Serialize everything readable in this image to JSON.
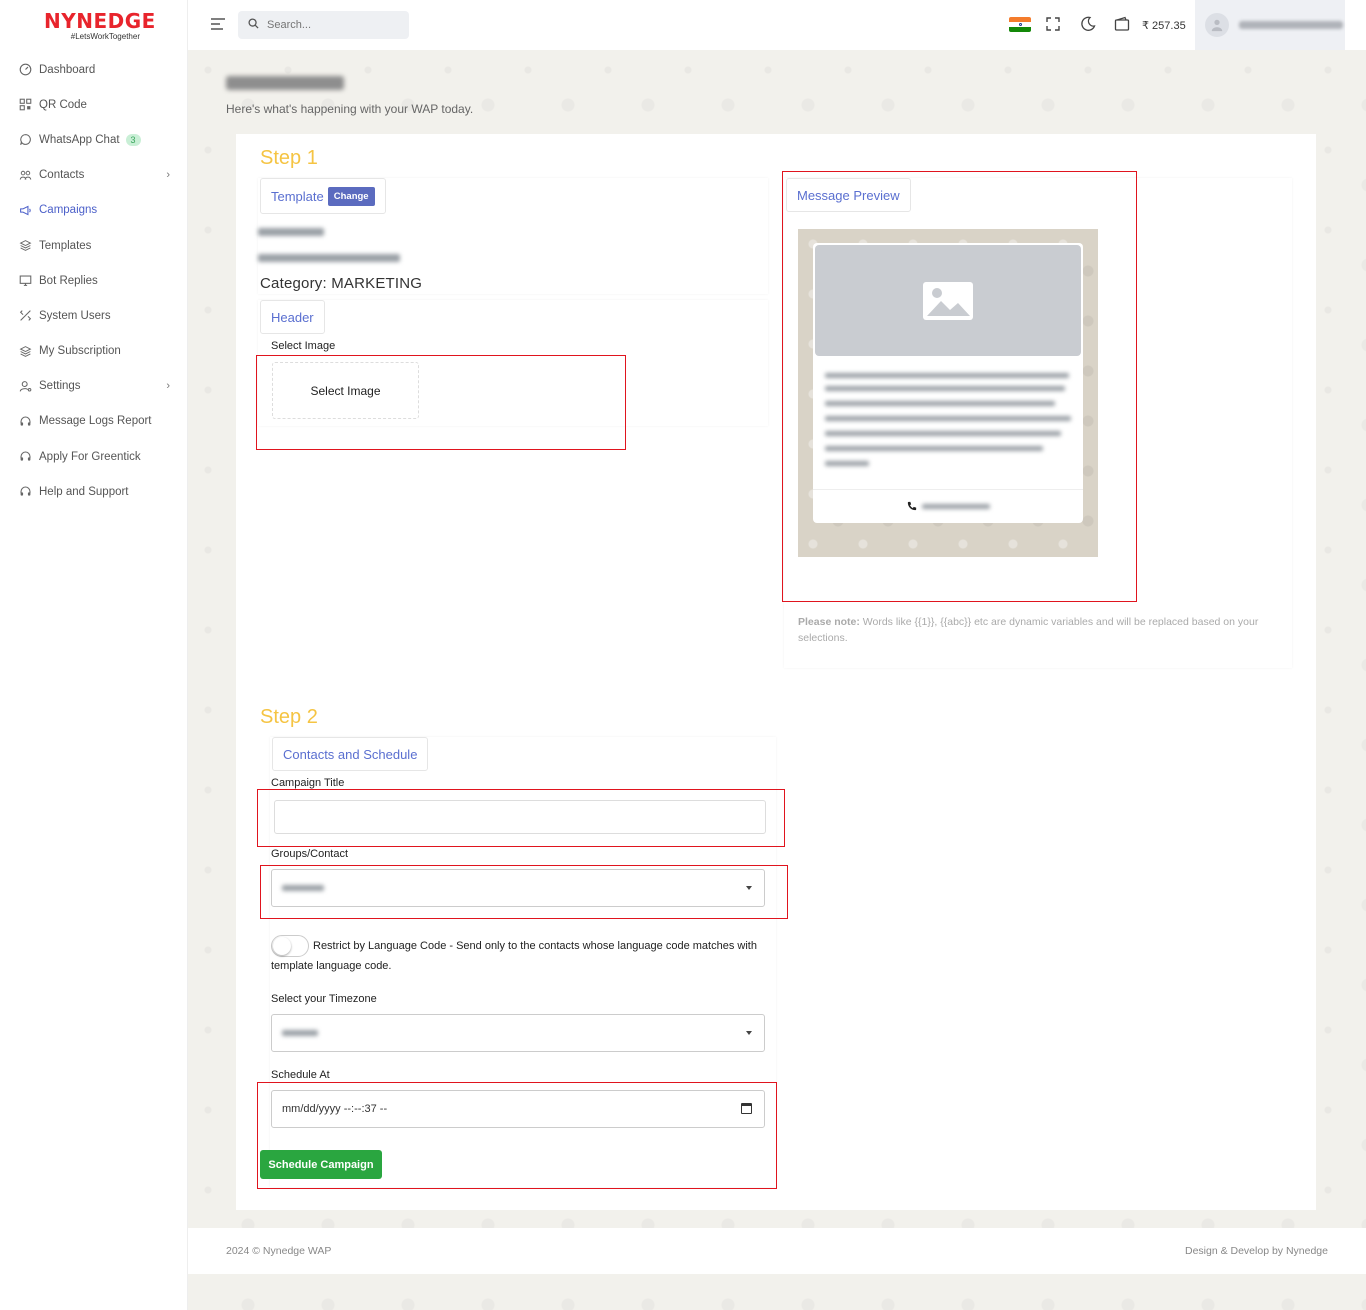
{
  "brand": {
    "name": "NYNEDGE",
    "tagline": "#LetsWorkTogether"
  },
  "sidebar": {
    "items": [
      {
        "label": "Dashboard",
        "icon": "dashboard-icon"
      },
      {
        "label": "QR Code",
        "icon": "qr-code-icon"
      },
      {
        "label": "WhatsApp Chat",
        "icon": "chat-icon",
        "badge": "3"
      },
      {
        "label": "Contacts",
        "icon": "contacts-icon",
        "has_submenu": true
      },
      {
        "label": "Campaigns",
        "icon": "megaphone-icon",
        "active": true
      },
      {
        "label": "Templates",
        "icon": "layers-icon"
      },
      {
        "label": "Bot Replies",
        "icon": "monitor-icon"
      },
      {
        "label": "System Users",
        "icon": "users-cog-icon"
      },
      {
        "label": "My Subscription",
        "icon": "layers-icon"
      },
      {
        "label": "Settings",
        "icon": "user-settings-icon",
        "has_submenu": true
      },
      {
        "label": "Message Logs Report",
        "icon": "headset-icon"
      },
      {
        "label": "Apply For Greentick",
        "icon": "headset-icon"
      },
      {
        "label": "Help and Support",
        "icon": "headset-icon"
      }
    ]
  },
  "topbar": {
    "search_placeholder": "Search...",
    "balance": "₹ 257.35",
    "flag_colors": [
      "#f47c2c",
      "#ffffff",
      "#138808"
    ]
  },
  "page": {
    "subtitle": "Here's what's happening with your WAP today."
  },
  "step1": {
    "title": "Step 1",
    "template_label": "Template",
    "change_label": "Change",
    "category": "Category: MARKETING",
    "header_tab": "Header",
    "select_image_label": "Select Image",
    "select_image_button": "Select Image",
    "preview_tab": "Message Preview",
    "note_bold": "Please note:",
    "note_text": " Words like {{1}}, {{abc}} etc are dynamic variables and will be replaced based on your selections."
  },
  "step2": {
    "title": "Step 2",
    "tab": "Contacts and Schedule",
    "campaign_title_label": "Campaign Title",
    "campaign_title_value": "",
    "groups_label": "Groups/Contact",
    "restrict_text": "Restrict by Language Code - Send only to the contacts whose language code matches with template language code.",
    "restrict_enabled": false,
    "timezone_label": "Select your Timezone",
    "schedule_label": "Schedule At",
    "schedule_value": "mm/dd/yyyy --:--:37 --",
    "schedule_button": "Schedule Campaign"
  },
  "footer": {
    "left": "2024 © Nynedge WAP",
    "right": "Design & Develop by Nynedge"
  },
  "colors": {
    "accent": "#4b5fc9",
    "step_title": "#f5c443",
    "primary_button": "#2aa640",
    "highlight_box": "#e0141e"
  }
}
